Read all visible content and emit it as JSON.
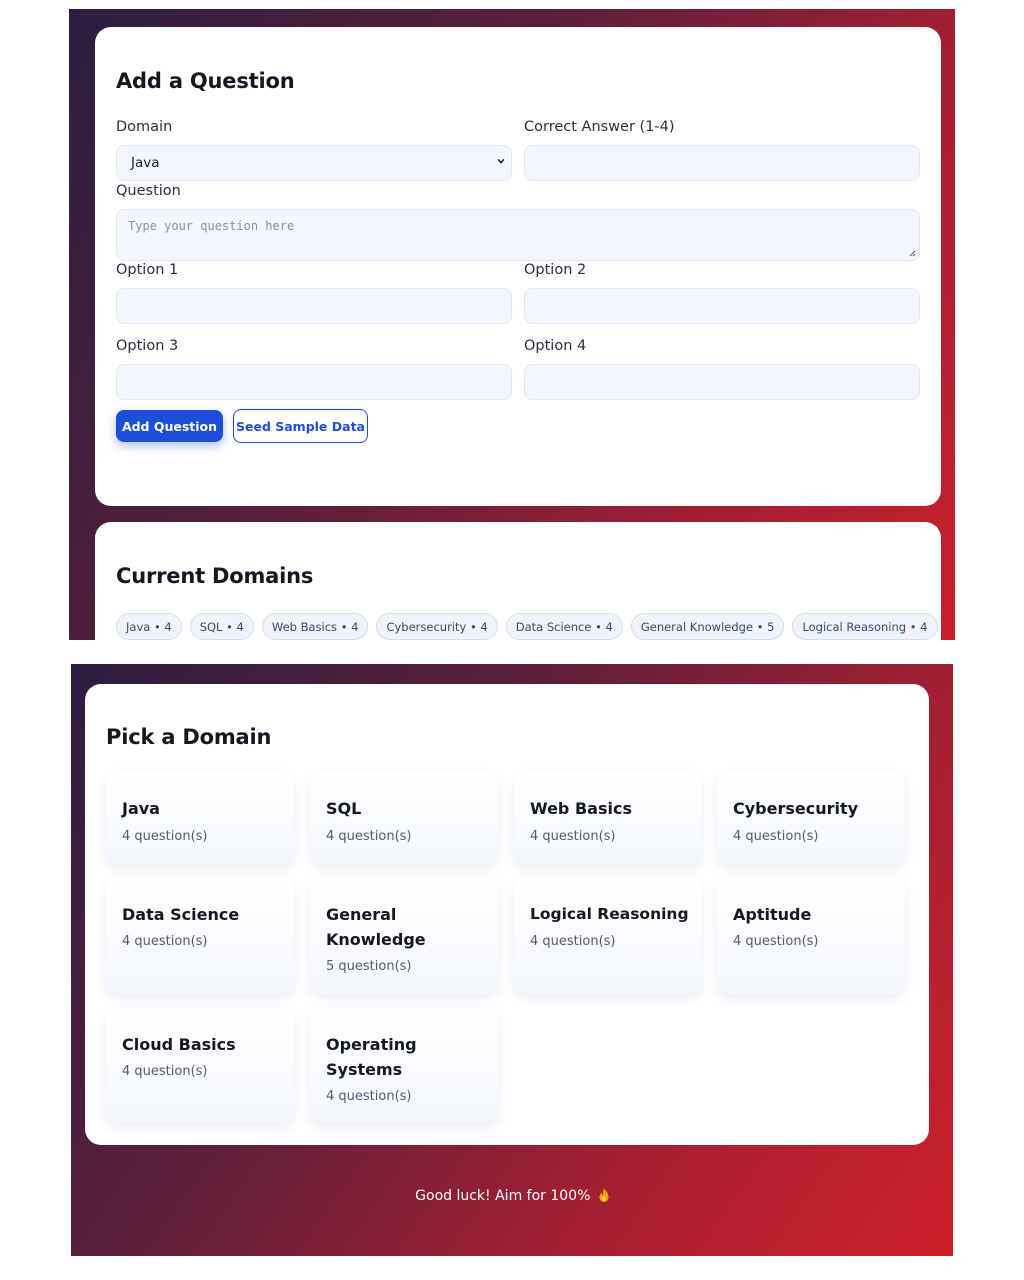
{
  "add_question": {
    "title": "Add a Question",
    "domain_label": "Domain",
    "domain_value": "Java",
    "correct_label": "Correct Answer (1-4)",
    "correct_value": "",
    "question_label": "Question",
    "question_placeholder": "Type your question here",
    "option1_label": "Option 1",
    "option2_label": "Option 2",
    "option3_label": "Option 3",
    "option4_label": "Option 4",
    "add_button": "Add Question",
    "seed_button": "Seed Sample Data"
  },
  "current_domains": {
    "title": "Current Domains",
    "chips": [
      "Java • 4",
      "SQL • 4",
      "Web Basics • 4",
      "Cybersecurity • 4",
      "Data Science • 4",
      "General Knowledge • 5",
      "Logical Reasoning • 4"
    ]
  },
  "pick_domain": {
    "title": "Pick a Domain",
    "tiles": [
      {
        "name": "Java",
        "count": "4 question(s)"
      },
      {
        "name": "SQL",
        "count": "4 question(s)"
      },
      {
        "name": "Web Basics",
        "count": "4 question(s)"
      },
      {
        "name": "Cybersecurity",
        "count": "4 question(s)"
      },
      {
        "name": "Data Science",
        "count": "4 question(s)"
      },
      {
        "name": "General Knowledge",
        "count": "5 question(s)"
      },
      {
        "name": "Logical Reasoning",
        "count": "4 question(s)"
      },
      {
        "name": "Aptitude",
        "count": "4 question(s)"
      },
      {
        "name": "Cloud Basics",
        "count": "4 question(s)"
      },
      {
        "name": "Operating Systems",
        "count": "4 question(s)"
      }
    ]
  },
  "footer": {
    "text": "Good luck! Aim for 100%",
    "icon": "fire-icon"
  },
  "colors": {
    "primary": "#1d4ed8",
    "gradient_start": "#2c1e40",
    "gradient_end": "#c8202b"
  }
}
